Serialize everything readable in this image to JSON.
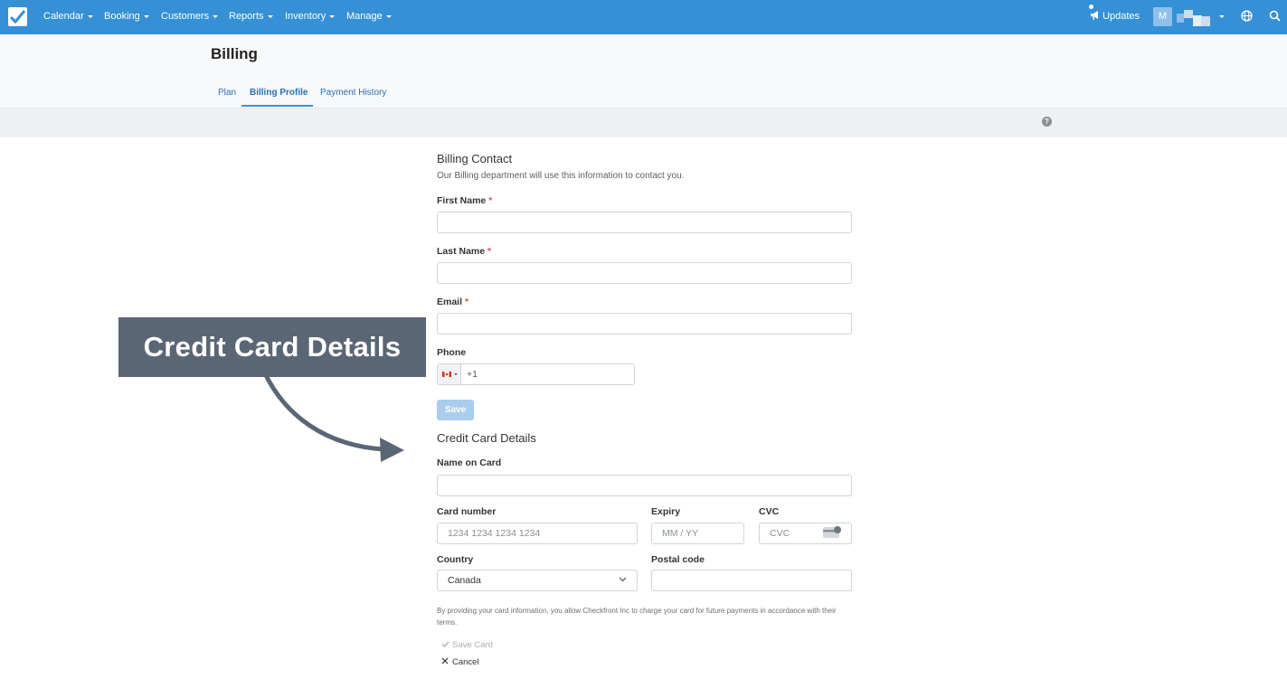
{
  "nav": {
    "items": [
      "Calendar",
      "Booking",
      "Customers",
      "Reports",
      "Inventory",
      "Manage"
    ],
    "updates_label": "Updates",
    "avatar_initial": "M",
    "brand_color": "#3590d6"
  },
  "header": {
    "title": "Billing",
    "tabs": [
      "Plan",
      "Billing Profile",
      "Payment History"
    ],
    "active_tab": "Billing Profile"
  },
  "help_glyph": "?",
  "billing_contact": {
    "title": "Billing Contact",
    "subtitle": "Our Billing department will use this information to contact you.",
    "first_name_label": "First Name",
    "last_name_label": "Last Name",
    "email_label": "Email",
    "required_mark": "*",
    "phone_label": "Phone",
    "phone_code": "+1",
    "save_label": "Save"
  },
  "card": {
    "title": "Credit Card Details",
    "name_label": "Name on Card",
    "number_label": "Card number",
    "number_placeholder": "1234 1234 1234 1234",
    "expiry_label": "Expiry",
    "expiry_placeholder": "MM / YY",
    "cvc_label": "CVC",
    "cvc_placeholder": "CVC",
    "country_label": "Country",
    "country_value": "Canada",
    "postal_label": "Postal code",
    "consent": "By providing your card information, you allow Checkfront Inc to charge your card for future payments in accordance with their terms.",
    "save_card_label": "Save Card",
    "cancel_label": "Cancel"
  },
  "annotation": {
    "label": "Credit Card Details"
  }
}
